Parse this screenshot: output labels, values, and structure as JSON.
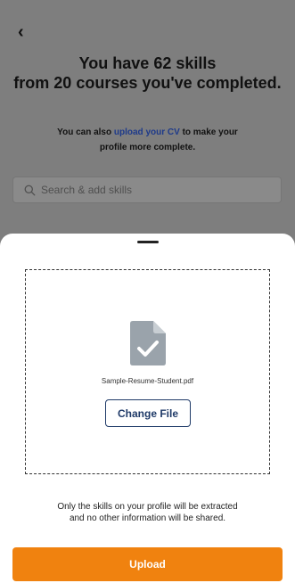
{
  "background": {
    "back_icon": "chevron-left-icon",
    "headline_line1": "You have 62 skills",
    "headline_line2": "from 20 courses you've completed.",
    "sub_prefix": "You can also ",
    "sub_link": "upload your CV",
    "sub_suffix_line1": " to make your",
    "sub_line2": "profile more complete.",
    "search_placeholder": "Search & add skills",
    "search_icon": "search-icon"
  },
  "sheet": {
    "file_icon": "document-check-icon",
    "file_name": "Sample-Resume-Student.pdf",
    "change_file_label": "Change File",
    "disclaimer_line1": "Only the skills on your profile will be extracted",
    "disclaimer_line2": "and no other information will be shared.",
    "upload_label": "Upload"
  },
  "colors": {
    "overlay": "#7e7e7e",
    "link": "#1e3a8a",
    "button_outline": "#1f3a68",
    "primary": "#f0820f",
    "file_icon": "#9aa3ab"
  }
}
